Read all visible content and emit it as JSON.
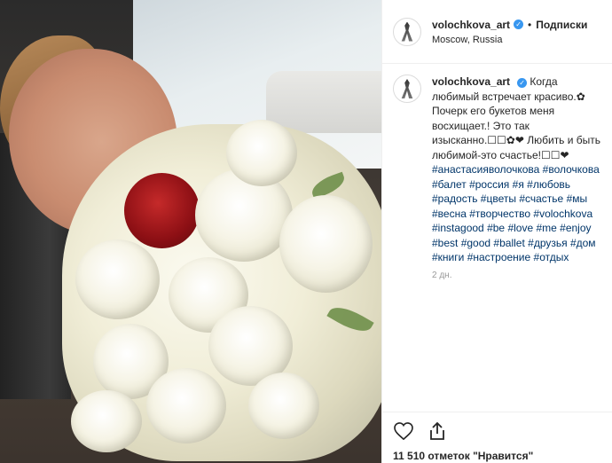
{
  "post": {
    "username": "volochkova_art",
    "verified_mark": "✓",
    "dot": "•",
    "follow_label": "Подписки",
    "location": "Moscow, Russia"
  },
  "caption": {
    "username": "volochkova_art",
    "text": "Когда любимый встречает красиво.✿ Почерк его букетов меня восхищает.! Это так изысканно.☐☐✿❤ Любить и быть любимой-это счастье!☐☐❤",
    "hashtags": [
      "#анастасияволочкова",
      "#волочкова",
      "#балет",
      "#россия",
      "#я",
      "#любовь",
      "#радость",
      "#цветы",
      "#счастье",
      "#мы",
      "#весна",
      "#творчество",
      "#volochkova",
      "#instagood",
      "#be",
      "#love",
      "#me",
      "#enjoy",
      "#best",
      "#good",
      "#ballet",
      "#друзья",
      "#дом",
      "#книги",
      "#настроение",
      "#отдых"
    ],
    "time_ago": "2 дн."
  },
  "actions": {
    "like_icon": "heart-icon",
    "share_icon": "share-icon",
    "likes_text": "11 510 отметок \"Нравится\""
  },
  "colors": {
    "hashtag": "#003569",
    "verified": "#3897f0",
    "muted": "#999999",
    "border": "#efefef"
  }
}
